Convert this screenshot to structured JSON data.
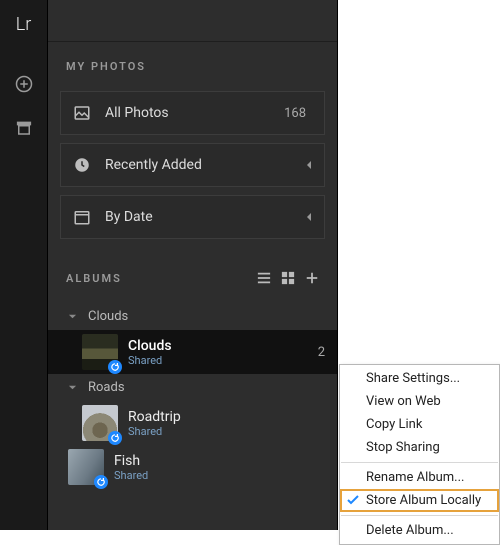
{
  "app": {
    "logo": "Lr"
  },
  "sections": {
    "my_photos_label": "MY PHOTOS",
    "albums_label": "ALBUMS"
  },
  "my_photos": {
    "all": {
      "label": "All Photos",
      "count": "168"
    },
    "recent": {
      "label": "Recently Added"
    },
    "bydate": {
      "label": "By Date"
    }
  },
  "albums": {
    "folders": [
      {
        "name": "Clouds",
        "items": [
          {
            "name": "Clouds",
            "sub": "Shared",
            "count": "2",
            "selected": true,
            "thumb": "clouds",
            "sync": true
          }
        ]
      },
      {
        "name": "Roads",
        "items": [
          {
            "name": "Roadtrip",
            "sub": "Shared",
            "thumb": "road",
            "sync": true
          }
        ]
      }
    ],
    "loose": [
      {
        "name": "Fish",
        "sub": "Shared",
        "thumb": "fish",
        "sync": true
      }
    ]
  },
  "context_menu": {
    "share_settings": "Share Settings...",
    "view_on_web": "View on Web",
    "copy_link": "Copy Link",
    "stop_sharing": "Stop Sharing",
    "rename": "Rename Album...",
    "store_local": "Store Album Locally",
    "delete": "Delete Album..."
  }
}
